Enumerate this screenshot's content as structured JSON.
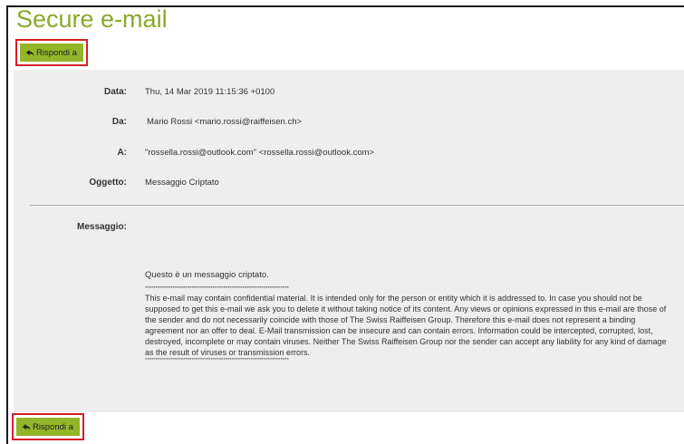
{
  "page": {
    "title": "Secure e-mail"
  },
  "actions": {
    "reply_label": "Rispondi a"
  },
  "header": {
    "fields": [
      {
        "label": "Data:",
        "value": "Thu, 14 Mar 2019 11:15:36 +0100"
      },
      {
        "label": "Da:",
        "value": "Mario Rossi <mario.rossi@raiffeisen.ch>"
      },
      {
        "label": "A:",
        "value": "\"rossella.rossi@outlook.com\" <rossella.rossi@outlook.com>"
      },
      {
        "label": "Oggetto:",
        "value": "Messaggio Criptato"
      }
    ]
  },
  "message": {
    "label": "Messaggio:",
    "intro": "Questo è un messaggio criptato.",
    "separator": "********************************************************************",
    "disclaimer": "This e-mail may contain confidential material. It is intended only for the person or entity which it is addressed to. In case you should not be supposed to get this e-mail we ask you to delete it without taking notice of its content. Any views or opinions expressed in this e-mail are those of the sender and do not necessarily coincide with those of The Swiss Raiffeisen Group. Therefore this e-mail does not represent a binding agreement nor an offer to deal. E-Mail transmission can be insecure and can contain errors. Information could be intercepted, corrupted, lost, destroyed, incomplete or may contain viruses. Neither The Swiss Raiffeisen Group nor the sender can accept any liability for any kind of damage as the result of viruses or transmission errors."
  },
  "colors": {
    "accent": "#8aa82a",
    "button": "#93b52a",
    "highlight_border": "#d61f26",
    "panel": "#eeeeee"
  },
  "icons": {
    "reply": "reply-arrow-icon"
  }
}
